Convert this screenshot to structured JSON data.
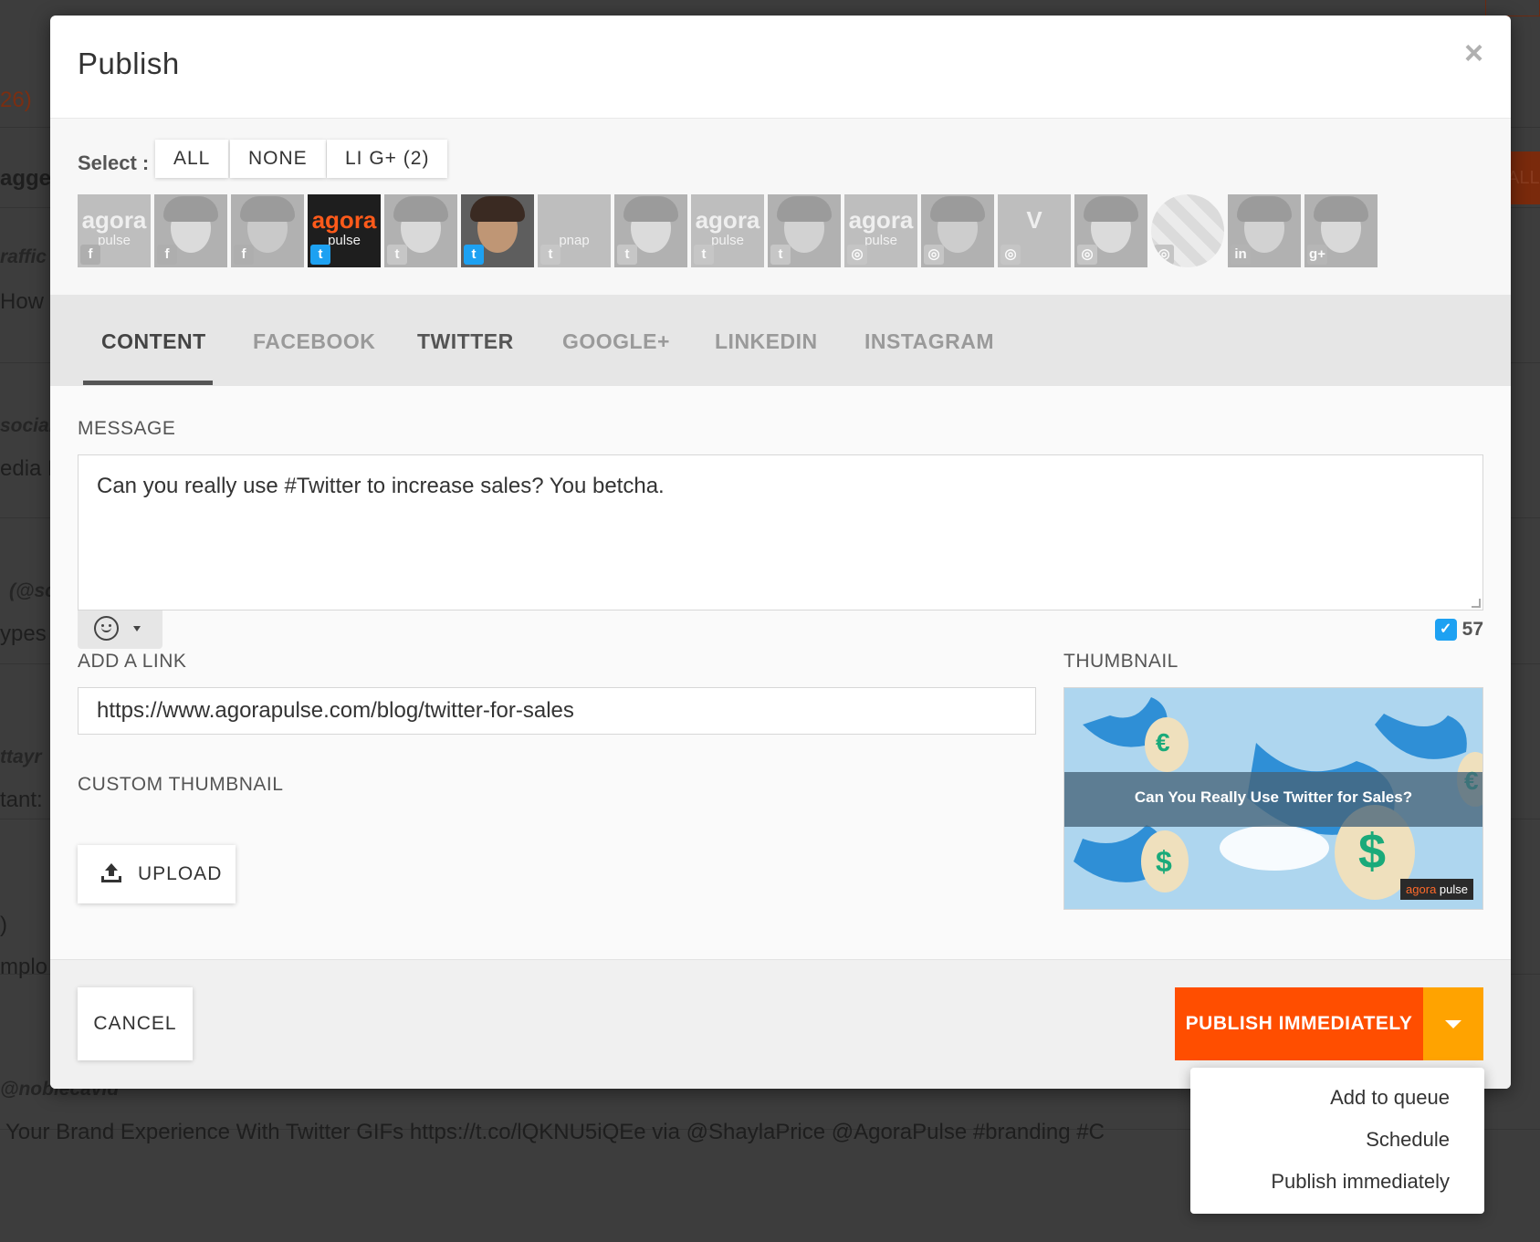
{
  "background": {
    "lines": [
      {
        "text": "26)",
        "kind": "orange"
      },
      {
        "text": "agge",
        "kind": "bold"
      },
      {
        "text": "raffic",
        "kind": "italic"
      },
      {
        "text": "How t",
        "kind": "normal"
      },
      {
        "text": "sociall",
        "kind": "italic"
      },
      {
        "text": "edia M",
        "kind": "normal"
      },
      {
        "text": "(@sc",
        "kind": "italic"
      },
      {
        "text": "ypes",
        "kind": "normal"
      },
      {
        "text": "ttayr",
        "kind": "italic"
      },
      {
        "text": "tant:",
        "kind": "normal"
      },
      {
        "text": ")",
        "kind": "normal"
      },
      {
        "text": "mplo",
        "kind": "normal"
      },
      {
        "text": "@noblecavid",
        "kind": "italic"
      },
      {
        "text": "Your Brand Experience With Twitter GIFs https://t.co/lQKNU5iQEe via @ShaylaPrice @AgoraPulse #branding #C",
        "kind": "normal"
      }
    ],
    "right_button": "ALL"
  },
  "modal": {
    "title": "Publish",
    "close_symbol": "×"
  },
  "select": {
    "label": "Select :",
    "buttons": [
      "ALL",
      "NONE",
      "LI G+ (2)"
    ]
  },
  "profiles": [
    {
      "type": "logo",
      "logo_main": "agora",
      "logo_sub": "pulse",
      "network": "facebook",
      "badge": "f",
      "selected": false
    },
    {
      "type": "face",
      "network": "facebook",
      "badge": "f",
      "selected": false
    },
    {
      "type": "face",
      "network": "facebook",
      "badge": "f",
      "selected": false
    },
    {
      "type": "logo",
      "logo_main": "agora",
      "logo_sub": "pulse",
      "network": "twitter",
      "badge": "t",
      "selected": true
    },
    {
      "type": "face",
      "network": "twitter",
      "badge": "t",
      "selected": false
    },
    {
      "type": "face",
      "network": "twitter",
      "badge": "t",
      "selected": true
    },
    {
      "type": "logo",
      "logo_main": "",
      "logo_sub": "pnap",
      "network": "twitter",
      "badge": "t",
      "selected": false
    },
    {
      "type": "face",
      "network": "twitter",
      "badge": "t",
      "selected": false
    },
    {
      "type": "logo",
      "logo_main": "agora",
      "logo_sub": "pulse",
      "network": "twitter",
      "badge": "t",
      "selected": false
    },
    {
      "type": "face",
      "network": "twitter",
      "badge": "t",
      "selected": false
    },
    {
      "type": "logo",
      "logo_main": "agora",
      "logo_sub": "pulse",
      "network": "instagram",
      "badge": "◎",
      "selected": false
    },
    {
      "type": "face",
      "network": "instagram",
      "badge": "◎",
      "selected": false
    },
    {
      "type": "logo",
      "logo_main": "V",
      "logo_sub": "",
      "network": "instagram",
      "badge": "◎",
      "selected": false
    },
    {
      "type": "face",
      "network": "instagram",
      "badge": "◎",
      "selected": false
    },
    {
      "type": "pattern",
      "network": "instagram",
      "badge": "◎",
      "selected": false
    },
    {
      "type": "face",
      "network": "linkedin",
      "badge": "in",
      "selected": false
    },
    {
      "type": "face",
      "network": "googleplus",
      "badge": "g+",
      "selected": false
    }
  ],
  "tabs": [
    {
      "label": "CONTENT",
      "state": "active"
    },
    {
      "label": "FACEBOOK",
      "state": "inactive"
    },
    {
      "label": "TWITTER",
      "state": "semi"
    },
    {
      "label": "GOOGLE+",
      "state": "inactive"
    },
    {
      "label": "LINKEDIN",
      "state": "inactive"
    },
    {
      "label": "INSTAGRAM",
      "state": "inactive"
    }
  ],
  "content": {
    "message_label": "MESSAGE",
    "message": "Can you really use #Twitter to increase sales? You betcha.",
    "char_count": "57",
    "link_label": "ADD A LINK",
    "link_value": "https://www.agorapulse.com/blog/twitter-for-sales",
    "custom_thumbnail_label": "CUSTOM THUMBNAIL",
    "upload_label": "UPLOAD",
    "thumbnail_label": "THUMBNAIL",
    "thumbnail": {
      "banner_text": "Can You Really Use Twitter for Sales?",
      "brand_main": "agora",
      "brand_sub": "pulse",
      "symbols": [
        "€",
        "$",
        "$",
        "€"
      ]
    }
  },
  "footer": {
    "cancel_label": "CANCEL",
    "publish_label": "PUBLISH IMMEDIATELY"
  },
  "dropdown": {
    "items": [
      "Add to queue",
      "Schedule",
      "Publish immediately"
    ]
  },
  "colors": {
    "publish": "#ff4e00",
    "caret": "#ffa300",
    "twitter": "#1da1f2",
    "facebook": "#3b5998",
    "linkedin": "#0077b5",
    "instagram": "#8a8a8a",
    "googleplus": "#dd4b39"
  }
}
